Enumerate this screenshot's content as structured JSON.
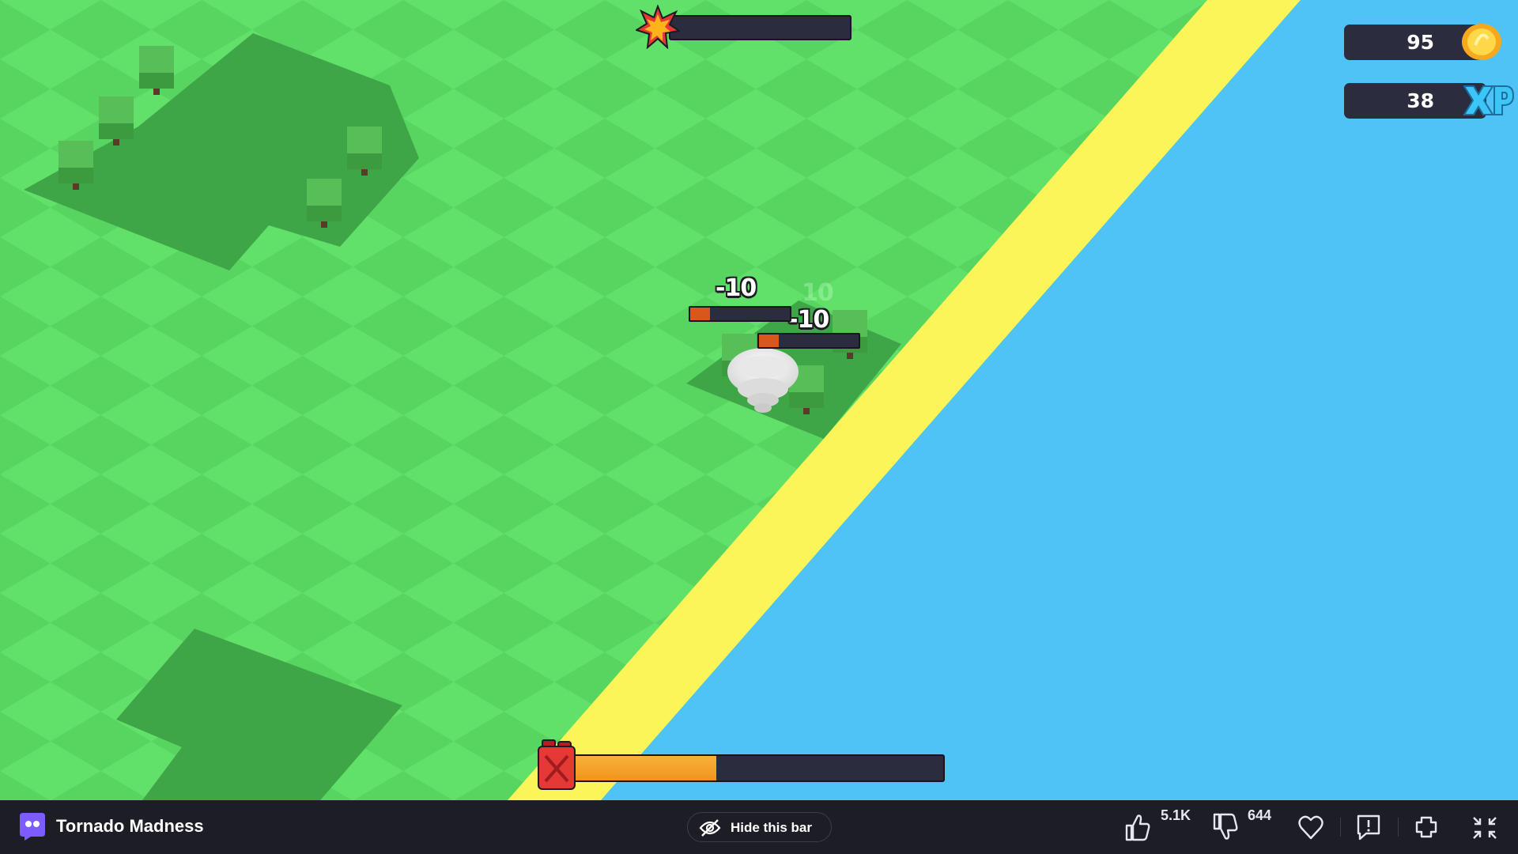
{
  "game": {
    "title": "Tornado Madness"
  },
  "hud": {
    "coins": "95",
    "xp": "38",
    "power_progress": 0,
    "fuel_progress": 0.39,
    "damage_popups": [
      "-10",
      "-10",
      "10"
    ],
    "tree_health": [
      0.2,
      0.2
    ]
  },
  "colors": {
    "grass_light": "#61e06a",
    "grass_dark": "#58d561",
    "grass_shade": "#3fa647",
    "sand": "#fbf55a",
    "water": "#4fc3f5",
    "tree": "#3c9a3f",
    "hud_bg": "#2b2c3d",
    "fuel": "#f2941b",
    "health": "#d9561c"
  },
  "icons": {
    "power": "explosion-star-icon",
    "coin": "gold-coin-icon",
    "xp": "xp-icon",
    "fuel": "fuel-can-icon",
    "tornado": "tornado-player"
  },
  "bottom_bar": {
    "hide_label": "Hide this bar",
    "likes": "5.1K",
    "dislikes": "644"
  }
}
